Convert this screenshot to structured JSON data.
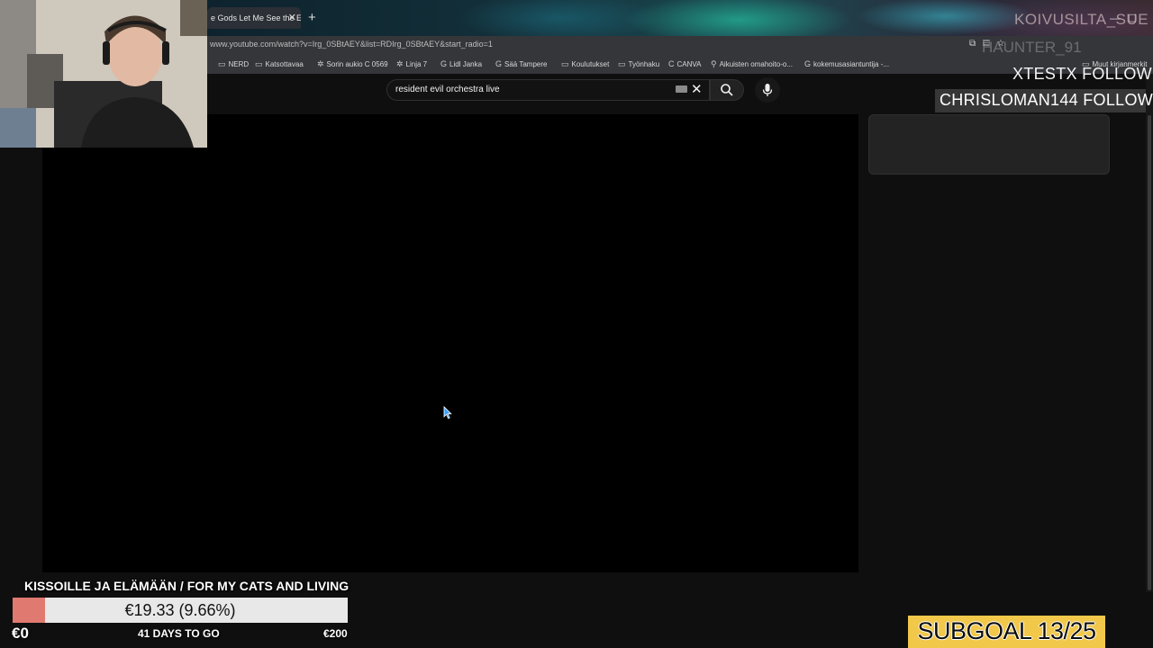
{
  "browser": {
    "tab_title": "e Gods Let Me See the E",
    "tab_close": "✕",
    "new_tab": "+",
    "url": "www.youtube.com/watch?v=Irg_0SBtAEY&list=RDIrg_0SBtAEY&start_radio=1",
    "bookmarks": [
      {
        "icon": "folder-icon",
        "label": "NERD"
      },
      {
        "icon": "folder-icon",
        "label": "Katsottavaa"
      },
      {
        "icon": "gear-icon",
        "label": "Sorin aukio C 0569"
      },
      {
        "icon": "gear-icon",
        "label": "Linja 7"
      },
      {
        "icon": "google-icon",
        "label": "Lidl Janka"
      },
      {
        "icon": "google-icon",
        "label": "Sää Tampere"
      },
      {
        "icon": "folder-icon",
        "label": "Koulutukset"
      },
      {
        "icon": "folder-icon",
        "label": "Työnhaku"
      },
      {
        "icon": "canva-icon",
        "label": "CANVA"
      },
      {
        "icon": "pin-icon",
        "label": "Aikuisten omahoito-o..."
      },
      {
        "icon": "google-icon",
        "label": "kokemusasiantuntija -..."
      },
      {
        "icon": "folder-icon",
        "label": "Muut kirjanmerkit"
      }
    ]
  },
  "youtube": {
    "search_query": "resident evil orchestra live"
  },
  "overlay": {
    "alert_name": "KOIVUSILTA_SUE",
    "alert_name2": "HAUNTER_91",
    "follow1": "XTESTX  FOLLOW",
    "follow2": "CHRISLOMAN144  FOLLOW",
    "goal_title": "KISSOILLE JA ELÄMÄÄN / FOR MY CATS AND LIVING",
    "goal_amount": "€19.33 (9.66%)",
    "goal_progress": 0.0966,
    "goal_start": "€0",
    "goal_days": "41 DAYS TO GO",
    "goal_end": "€200",
    "subgoal": "SUBGOAL 13/25"
  },
  "colors": {
    "goal_fill": "#e07a70",
    "subgoal_bg": "#f1c84a",
    "yt_bg": "#0f0f0f"
  }
}
